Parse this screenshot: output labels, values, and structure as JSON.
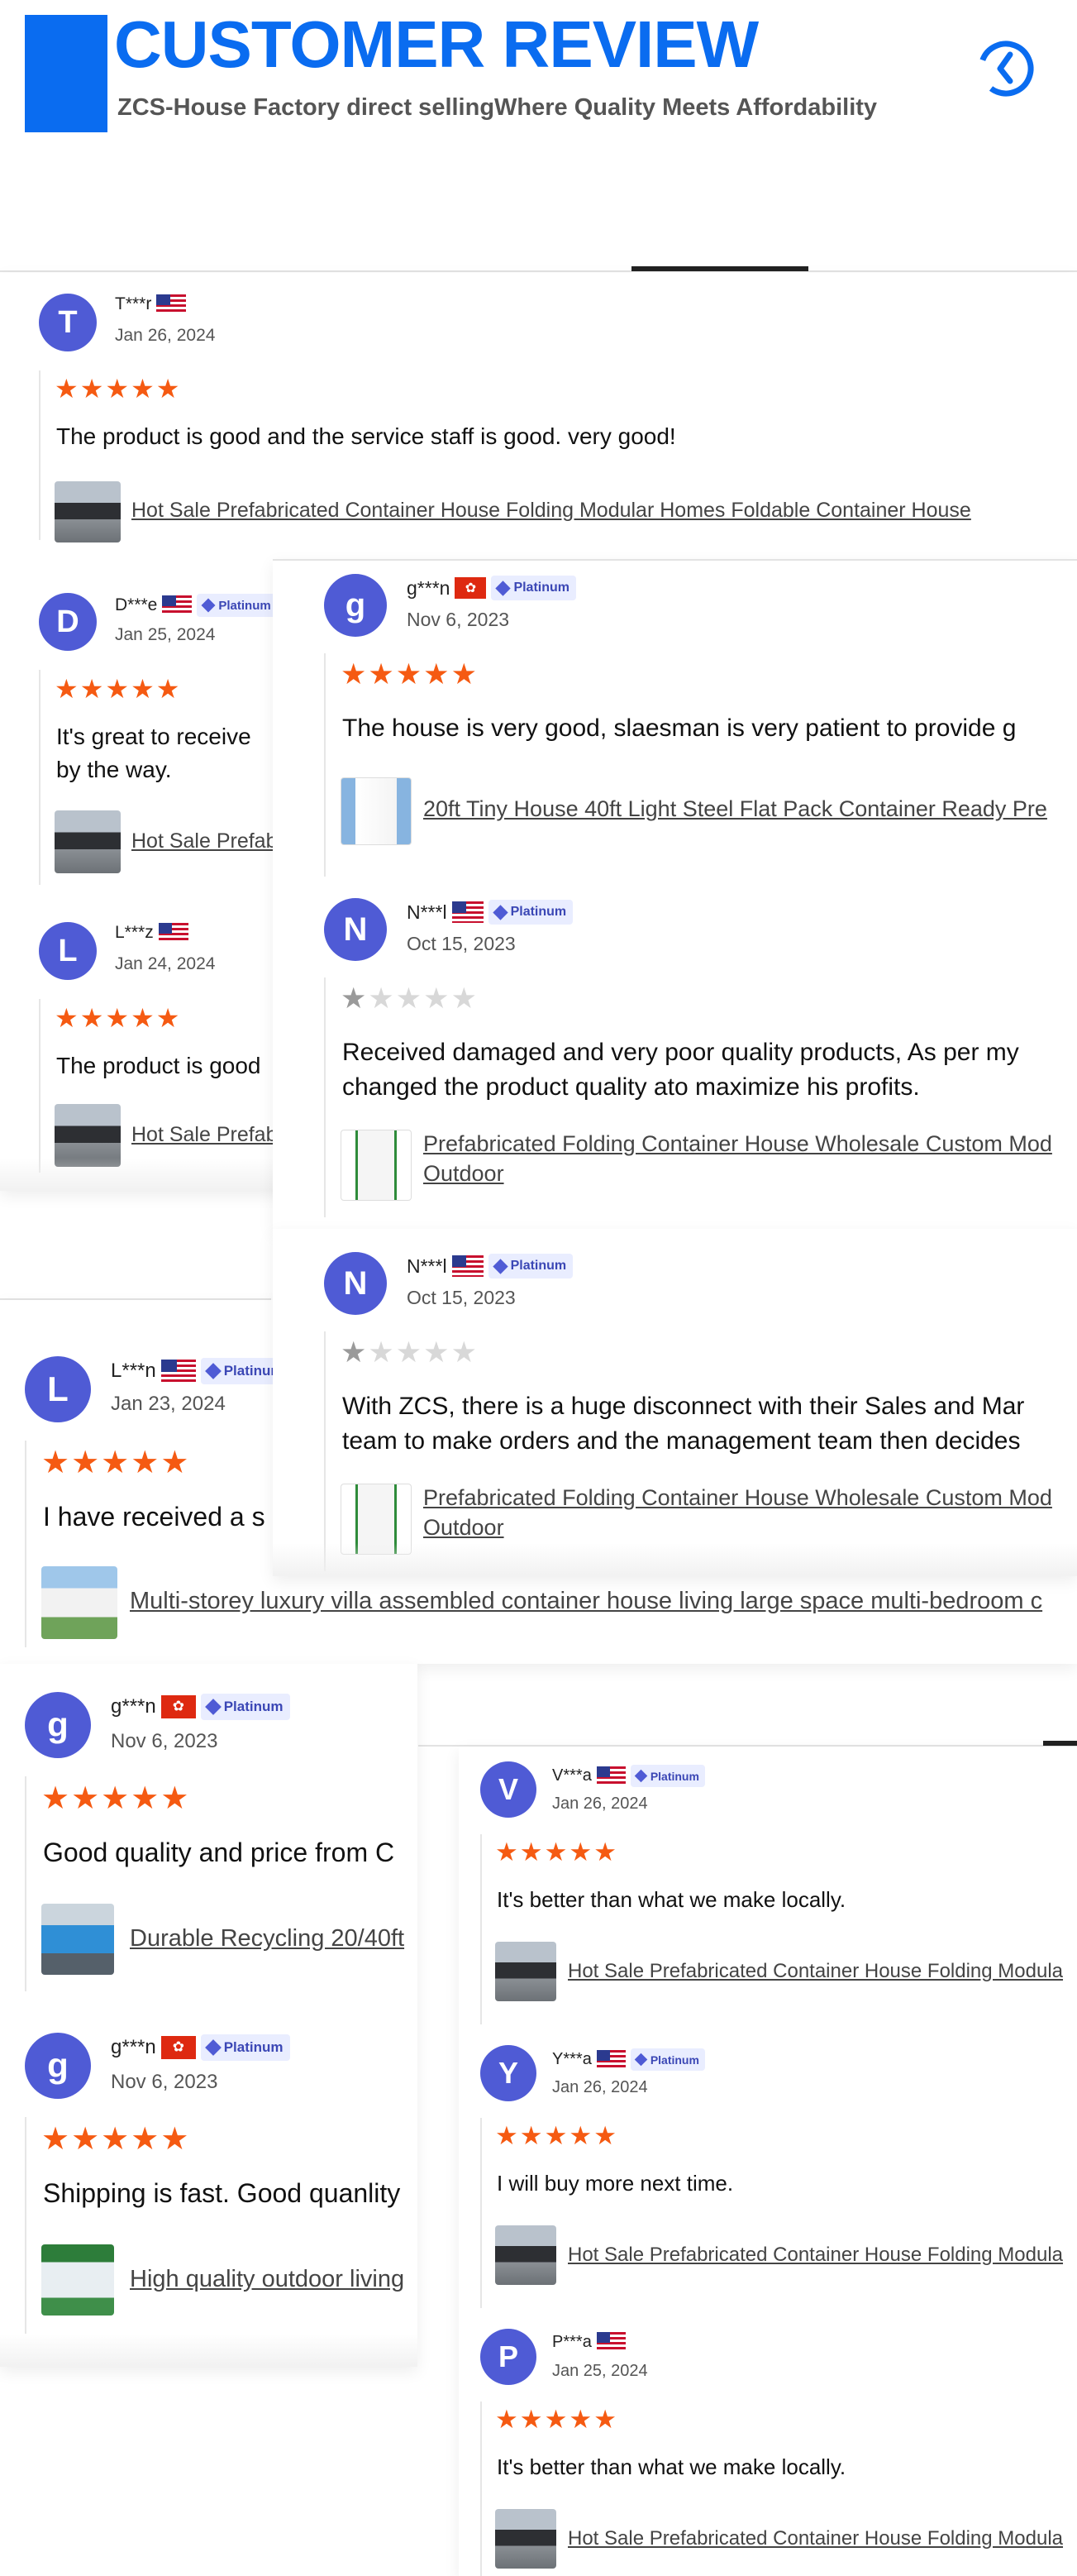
{
  "header": {
    "title": "CUSTOMER REVIEW",
    "subtitle": "ZCS-House Factory direct sellingWhere Quality Meets Affordability",
    "icon": "history-icon",
    "accent": "#0a6cf0"
  },
  "colors": {
    "star": "#f55a12",
    "avatar": "#4f5bd5",
    "badge_bg": "#e9edff"
  },
  "badge_label": "Platinum",
  "panels": {
    "p1": {
      "reviews": [
        {
          "initial": "T",
          "name": "T***r",
          "flag": "us",
          "platinum": false,
          "date": "Jan 26, 2024",
          "rating": 5,
          "text": "The product is good and the service staff is good. very good!",
          "product": "Hot Sale Prefabricated Container House Folding Modular Homes Foldable Container House",
          "thumb": "house"
        },
        {
          "initial": "D",
          "name": "D***e",
          "flag": "us",
          "platinum": true,
          "date": "Jan 25, 2024",
          "rating": 5,
          "text": "It's great to receive",
          "text2": "by the way.",
          "product": "Hot Sale Prefab",
          "thumb": "house"
        },
        {
          "initial": "L",
          "name": "L***z",
          "flag": "us",
          "platinum": false,
          "date": "Jan 24, 2024",
          "rating": 5,
          "text": "The product is good",
          "product": "Hot Sale Prefab",
          "thumb": "house"
        }
      ]
    },
    "p2": {
      "reviews": [
        {
          "initial": "g",
          "name": "g***n",
          "flag": "hk",
          "platinum": true,
          "date": "Nov 6, 2023",
          "rating": 5,
          "text": "The house is very good, slaesman is very patient to provide g",
          "product": "20ft Tiny House 40ft Light Steel Flat Pack Container Ready Pre",
          "thumb": "tiny"
        },
        {
          "initial": "N",
          "name": "N***l",
          "flag": "us",
          "platinum": true,
          "date": "Oct 15, 2023",
          "rating": 1,
          "text": "Received damaged and very poor quality products, As per my",
          "text2": "changed the product quality ato maximize his profits.",
          "product": "Prefabricated Folding Container House Wholesale Custom Mod",
          "product2": "Outdoor",
          "thumb": "fold"
        }
      ]
    },
    "p3": {
      "reviews": [
        {
          "initial": "N",
          "name": "N***l",
          "flag": "us",
          "platinum": true,
          "date": "Oct 15, 2023",
          "rating": 1,
          "text": "With ZCS, there is a huge disconnect with their Sales and Mar",
          "text2": "team to make orders and the management team then decides",
          "product": "Prefabricated Folding Container House Wholesale Custom Mod",
          "product2": "Outdoor",
          "thumb": "fold"
        }
      ]
    },
    "p4": {
      "reviews": [
        {
          "initial": "L",
          "name": "L***n",
          "flag": "us",
          "platinum": true,
          "date": "Jan 23, 2024",
          "rating": 5,
          "text": "I have received a s",
          "product": "Multi-storey luxury villa assembled container house living large space multi-bedroom c",
          "thumb": "villa"
        }
      ]
    },
    "p5": {
      "reviews": [
        {
          "initial": "g",
          "name": "g***n",
          "flag": "hk",
          "platinum": true,
          "date": "Nov 6, 2023",
          "rating": 5,
          "text": "Good quality and price from C",
          "product": "Durable Recycling 20/40ft",
          "thumb": "blue"
        },
        {
          "initial": "g",
          "name": "g***n",
          "flag": "hk",
          "platinum": true,
          "date": "Nov 6, 2023",
          "rating": 5,
          "text": "Shipping is fast. Good quanlity",
          "product": "High quality outdoor living",
          "thumb": "outdoor"
        }
      ]
    },
    "p6": {
      "reviews": [
        {
          "initial": "V",
          "name": "V***a",
          "flag": "us",
          "platinum": true,
          "date": "Jan 26, 2024",
          "rating": 5,
          "text": "It's better than what we make locally.",
          "product": "Hot Sale Prefabricated Container House Folding Modula",
          "thumb": "house"
        },
        {
          "initial": "Y",
          "name": "Y***a",
          "flag": "us",
          "platinum": true,
          "date": "Jan 26, 2024",
          "rating": 5,
          "text": "I will buy more next time.",
          "product": "Hot Sale Prefabricated Container House Folding Modula",
          "thumb": "house"
        },
        {
          "initial": "P",
          "name": "P***a",
          "flag": "us",
          "platinum": false,
          "date": "Jan 25, 2024",
          "rating": 5,
          "text": "It's better than what we make locally.",
          "product": "Hot Sale Prefabricated Container House Folding Modula",
          "thumb": "house"
        }
      ]
    }
  }
}
